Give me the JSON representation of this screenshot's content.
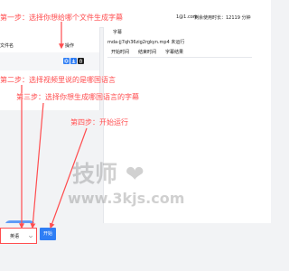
{
  "header": {
    "user": "1@1.com",
    "remaining_time": "剩余使用时长：12119 分钟"
  },
  "left_panel": {
    "column_file": "文件名",
    "column_action": "操作"
  },
  "right_panel": {
    "subtitle_label": "字幕",
    "task_text": "mda-jj7qh36zig2rgkyn.mp4 未运行",
    "tabs": [
      "开始时间",
      "结束时间",
      "字幕结果"
    ]
  },
  "steps": {
    "step1": "第一步：选择你想给哪个文件生成字幕",
    "step2": "第二步：选择视频里说的是哪国语言",
    "step3": "第三步：选择你想生成哪国语言的字幕",
    "step4": "第四步：开始运行"
  },
  "bottom": {
    "language": "英语",
    "start_button": "开始"
  },
  "watermark": {
    "logo_text": "技师",
    "url": "www.3kjs.com"
  },
  "icons": {
    "settings": "gear-icon",
    "download": "download-icon",
    "delete": "trash-icon",
    "dropdown": "chevron-down-icon",
    "watermark": "heart-icon"
  },
  "colors": {
    "accent": "#2f7ef5",
    "annotation": "#ff4d4f",
    "panel": "#ffffff",
    "background": "#f2f3f5"
  }
}
